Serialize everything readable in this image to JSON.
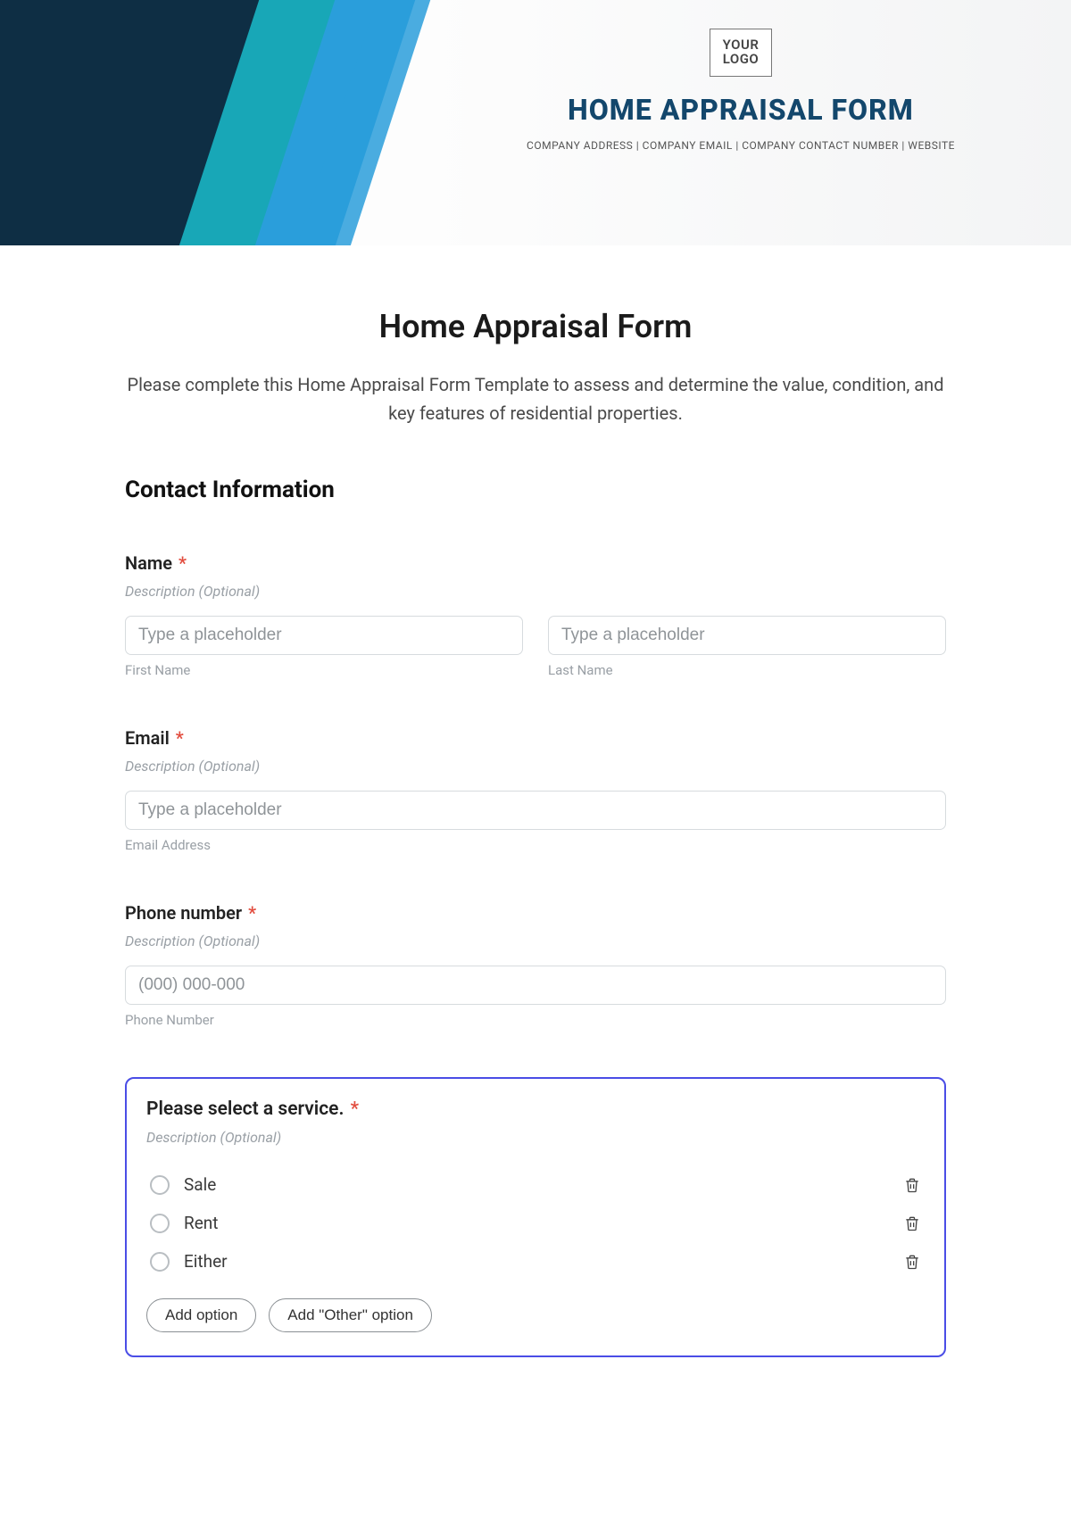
{
  "hero": {
    "logo_line1": "YOUR",
    "logo_line2": "LOGO",
    "title": "HOME APPRAISAL FORM",
    "subline": "COMPANY ADDRESS | COMPANY EMAIL | COMPANY CONTACT NUMBER | WEBSITE"
  },
  "form": {
    "title": "Home Appraisal Form",
    "description": "Please complete this Home Appraisal Form Template to assess and determine the value, condition, and key features of residential properties.",
    "section_heading": "Contact Information"
  },
  "fields": {
    "name": {
      "label": "Name",
      "required_mark": "*",
      "sublabel": "Description (Optional)",
      "first_placeholder": "Type a placeholder",
      "first_under": "First Name",
      "last_placeholder": "Type a placeholder",
      "last_under": "Last Name"
    },
    "email": {
      "label": "Email",
      "required_mark": "*",
      "sublabel": "Description (Optional)",
      "placeholder": "Type a placeholder",
      "under": "Email Address"
    },
    "phone": {
      "label": "Phone number",
      "required_mark": "*",
      "sublabel": "Description (Optional)",
      "placeholder": "(000) 000-000",
      "under": "Phone Number"
    },
    "service": {
      "label": "Please select a service.",
      "required_mark": "*",
      "sublabel": "Description (Optional)",
      "options": [
        "Sale",
        "Rent",
        "Either"
      ],
      "add_option_label": "Add option",
      "add_other_label": "Add \"Other\" option"
    }
  }
}
